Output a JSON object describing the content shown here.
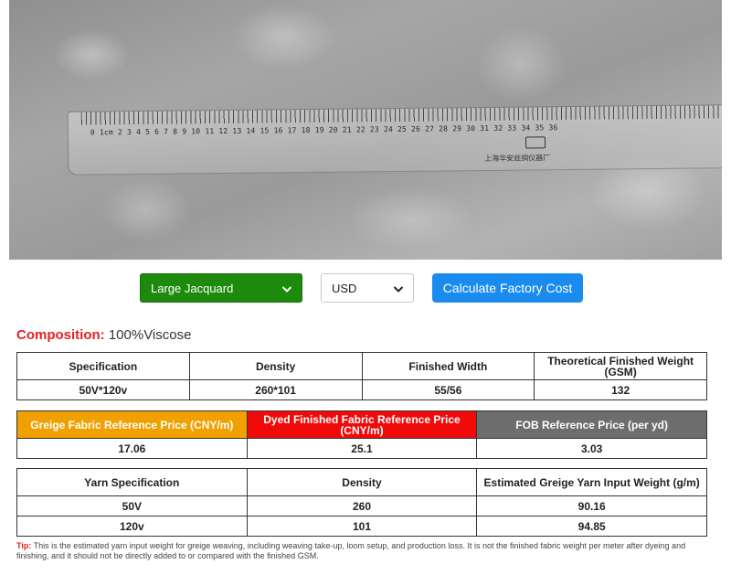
{
  "photo": {
    "ruler_numbers": "0  1cm 2   3    4    5    6    7    8    9   10   11   12   13   14   15   16   17   18   19   20   21   22   23   24   25   26   27   28   29   30   31   32   33   34   35   36",
    "ruler_maker": "上海华安丝绸仪器厂"
  },
  "controls": {
    "fabric_type": "Large Jacquard",
    "currency": "USD",
    "calculate_label": "Calculate Factory Cost"
  },
  "composition": {
    "label": "Composition:",
    "value": "100%Viscose"
  },
  "spec_table": {
    "headers": [
      "Specification",
      "Density",
      "Finished Width",
      "Theoretical Finished Weight (GSM)"
    ],
    "row": [
      "50V*120v",
      "260*101",
      "55/56",
      "132"
    ]
  },
  "price_table": {
    "headers": [
      "Greige Fabric Reference Price (CNY/m)",
      "Dyed Finished Fabric Reference Price (CNY/m)",
      "FOB Reference Price (per yd)"
    ],
    "row": [
      "17.06",
      "25.1",
      "3.03"
    ],
    "colors": {
      "greige": "#f0a000",
      "dyed": "#f00a0a",
      "fob": "#6d6d6d"
    }
  },
  "yarn_table": {
    "headers": [
      "Yarn Specification",
      "Density",
      "Estimated Greige Yarn Input Weight (g/m)"
    ],
    "rows": [
      [
        "50V",
        "260",
        "90.16"
      ],
      [
        "120v",
        "101",
        "94.85"
      ]
    ]
  },
  "tip": {
    "label": "Tip:",
    "text": " This is the estimated yarn input weight for greige weaving, including weaving take-up, loom setup, and production loss. It is not the finished fabric weight per meter after dyeing and finishing, and it should not be directly added to or compared with the finished GSM."
  },
  "colors": {
    "accent_green": "#1e8a0d",
    "accent_blue": "#1a8cf0",
    "accent_red": "#e32222"
  }
}
